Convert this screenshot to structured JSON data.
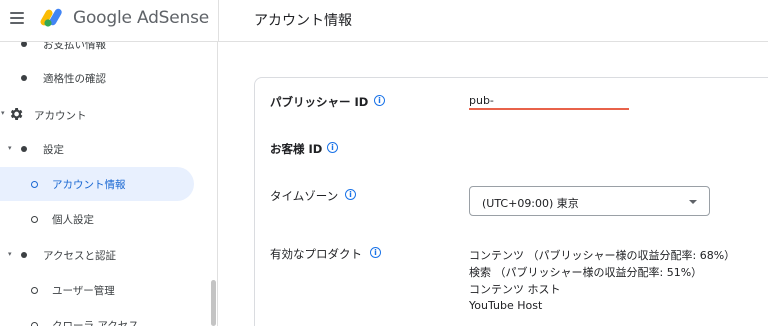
{
  "header": {
    "brand": "Google AdSense",
    "page_title": "アカウント情報",
    "logo_colors": [
      "#fbbc04",
      "#4285f4",
      "#34a853"
    ]
  },
  "sidebar": {
    "items": [
      {
        "label": "お支払い情報",
        "marker": "dot"
      },
      {
        "label": "適格性の確認",
        "marker": "dot"
      },
      {
        "label": "アカウント",
        "marker": "gear-icon",
        "expanded": true
      },
      {
        "label": "設定",
        "marker": "dot",
        "expanded": true
      },
      {
        "label": "アカウント情報",
        "marker": "ring",
        "active": true
      },
      {
        "label": "個人設定",
        "marker": "ring"
      },
      {
        "label": "アクセスと認証",
        "marker": "dot",
        "expanded": true
      },
      {
        "label": "ユーザー管理",
        "marker": "ring"
      },
      {
        "label": "クローラ アクセス",
        "marker": "ring"
      }
    ]
  },
  "account_info": {
    "publisher_id": {
      "label": "パブリッシャー ID",
      "value": "pub-"
    },
    "customer_id": {
      "label": "お客様 ID",
      "value": ""
    },
    "timezone": {
      "label": "タイムゾーン",
      "value": "(UTC+09:00) 東京"
    },
    "products": {
      "label": "有効なプロダクト",
      "values": [
        "コンテンツ （パブリッシャー様の収益分配率: 68%）",
        "検索 （パブリッシャー様の収益分配率: 51%）",
        "コンテンツ ホスト",
        "YouTube Host"
      ]
    }
  },
  "colors": {
    "accent": "#1a73e8",
    "active_bg": "#e8f0fe",
    "active_text": "#1967d2",
    "underline": "#e8624a"
  }
}
